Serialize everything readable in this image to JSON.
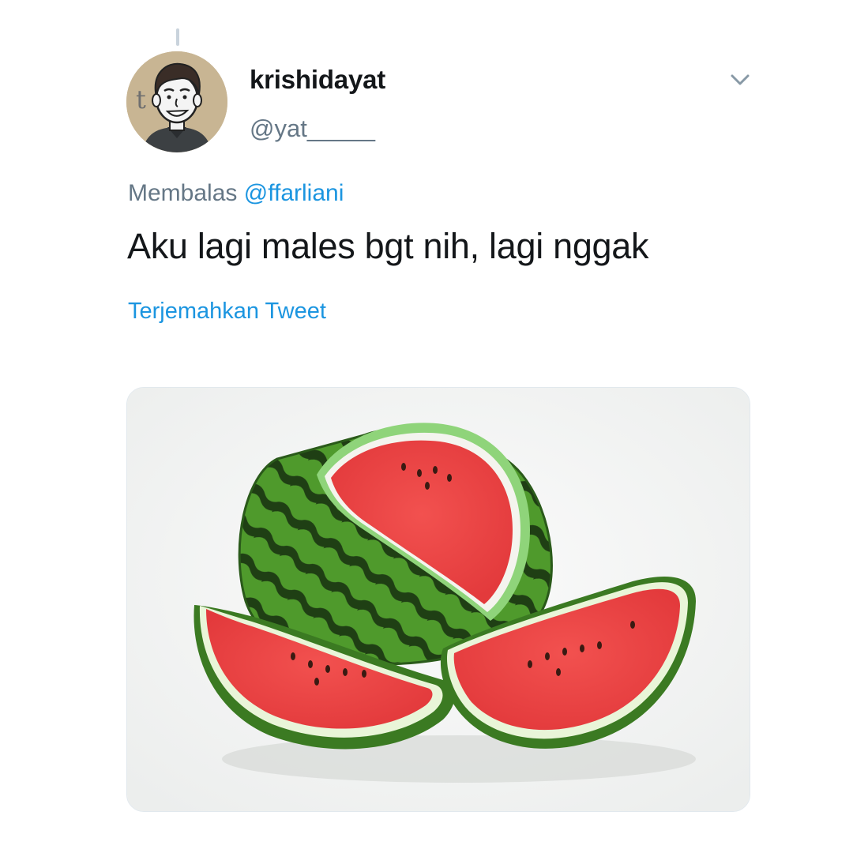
{
  "tweet": {
    "author": {
      "display_name": "krishidayat",
      "handle": "@yat_____",
      "avatar_icon": "cartoon-avatar-icon"
    },
    "reply_to": {
      "prefix": "Membalas",
      "mention": "@ffarliani"
    },
    "text": "Aku lagi males bgt nih, lagi nggak",
    "translate_label": "Terjemahkan Tweet",
    "menu_icon": "chevron-down-icon",
    "media": {
      "subject_icon": "watermelon-image-icon"
    }
  },
  "colors": {
    "text_primary": "#14171a",
    "text_secondary": "#657786",
    "link": "#1b95e0",
    "divider": "#e1e8ed"
  }
}
